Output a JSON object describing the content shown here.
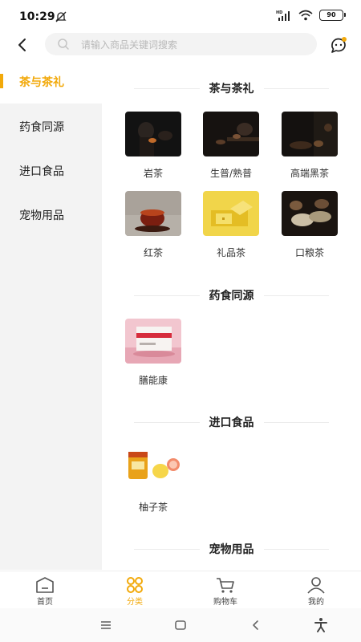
{
  "status_bar": {
    "time": "10:29",
    "battery": "90",
    "network": "HD"
  },
  "search": {
    "placeholder": "请输入商品关键词搜索"
  },
  "sidebar": {
    "items": [
      {
        "label": "茶与茶礼",
        "active": true
      },
      {
        "label": "药食同源",
        "active": false
      },
      {
        "label": "进口食品",
        "active": false
      },
      {
        "label": "宠物用品",
        "active": false
      }
    ]
  },
  "sections": [
    {
      "title": "茶与茶礼",
      "items": [
        {
          "label": "岩茶"
        },
        {
          "label": "生普/熟普"
        },
        {
          "label": "高端黑茶"
        },
        {
          "label": "红茶"
        },
        {
          "label": "礼品茶"
        },
        {
          "label": "口粮茶"
        }
      ]
    },
    {
      "title": "药食同源",
      "items": [
        {
          "label": "膳能康"
        }
      ]
    },
    {
      "title": "进口食品",
      "items": [
        {
          "label": "柚子茶"
        }
      ]
    },
    {
      "title": "宠物用品",
      "items": []
    }
  ],
  "tab_bar": {
    "tabs": [
      {
        "label": "首页",
        "icon": "home-icon"
      },
      {
        "label": "分类",
        "icon": "category-icon",
        "active": true
      },
      {
        "label": "购物车",
        "icon": "cart-icon"
      },
      {
        "label": "我的",
        "icon": "profile-icon"
      }
    ]
  },
  "colors": {
    "accent": "#f2a90a",
    "sidebar_bg": "#f3f3f3"
  }
}
